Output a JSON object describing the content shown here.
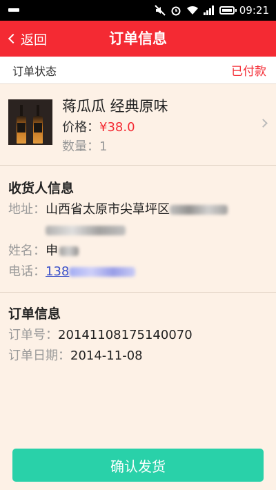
{
  "status_bar": {
    "time": "09:21"
  },
  "nav": {
    "back_label": "返回",
    "title": "订单信息"
  },
  "order_status": {
    "label": "订单状态",
    "value": "已付款"
  },
  "product": {
    "name": "蒋瓜瓜  经典原味",
    "price_label": "价格：",
    "price": "¥38.0",
    "qty_label": "数量：",
    "qty": "1"
  },
  "receiver": {
    "title": "收货人信息",
    "address_label": "地址：",
    "address_value": "山西省太原市尖草坪区",
    "name_label": "姓名：",
    "name_value": "申",
    "phone_label": "电话：",
    "phone_value": "138"
  },
  "order": {
    "title": "订单信息",
    "number_label": "订单号：",
    "number_value": "20141108175140070",
    "date_label": "订单日期：",
    "date_value": "2014-11-08"
  },
  "actions": {
    "confirm_label": "确认发货"
  },
  "colors": {
    "primary_red": "#f42a33",
    "confirm_green": "#29d1a9",
    "background": "#fdf1e6"
  }
}
